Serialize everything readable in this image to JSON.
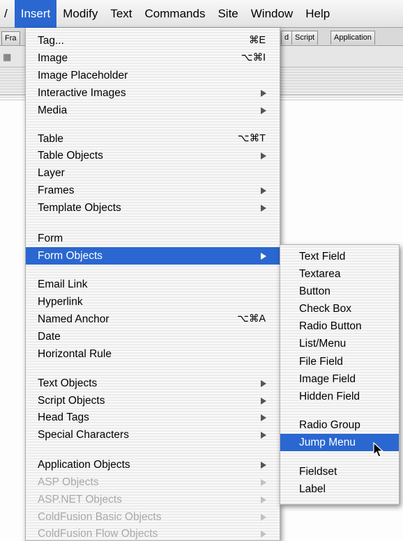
{
  "menubar": {
    "items": [
      {
        "label": "/"
      },
      {
        "label": "Insert",
        "active": true
      },
      {
        "label": "Modify"
      },
      {
        "label": "Text"
      },
      {
        "label": "Commands"
      },
      {
        "label": "Site"
      },
      {
        "label": "Window"
      },
      {
        "label": "Help"
      }
    ]
  },
  "insert_bar": {
    "left_tab": "Fra",
    "right_tabs": [
      "d",
      "Script",
      "Application"
    ]
  },
  "insert_menu": {
    "items": [
      {
        "label": "Tag...",
        "shortcut": "⌘E"
      },
      {
        "label": "Image",
        "shortcut": "⌥⌘I"
      },
      {
        "label": "Image Placeholder"
      },
      {
        "label": "Interactive Images",
        "submenu": true
      },
      {
        "label": "Media",
        "submenu": true
      },
      {
        "label": "Table",
        "shortcut": "⌥⌘T"
      },
      {
        "label": "Table Objects",
        "submenu": true
      },
      {
        "label": "Layer"
      },
      {
        "label": "Frames",
        "submenu": true
      },
      {
        "label": "Template Objects",
        "submenu": true
      },
      {
        "label": "Form"
      },
      {
        "label": "Form Objects",
        "submenu": true,
        "highlighted": true
      },
      {
        "label": "Email Link"
      },
      {
        "label": "Hyperlink"
      },
      {
        "label": "Named Anchor",
        "shortcut": "⌥⌘A"
      },
      {
        "label": "Date"
      },
      {
        "label": "Horizontal Rule"
      },
      {
        "label": "Text Objects",
        "submenu": true
      },
      {
        "label": "Script Objects",
        "submenu": true
      },
      {
        "label": "Head Tags",
        "submenu": true
      },
      {
        "label": "Special Characters",
        "submenu": true
      },
      {
        "label": "Application Objects",
        "submenu": true
      },
      {
        "label": "ASP Objects",
        "submenu": true,
        "disabled": true
      },
      {
        "label": "ASP.NET Objects",
        "submenu": true,
        "disabled": true
      },
      {
        "label": "ColdFusion Basic Objects",
        "submenu": true,
        "disabled": true
      },
      {
        "label": "ColdFusion Flow Objects",
        "submenu": true,
        "disabled": true
      }
    ]
  },
  "form_objects_submenu": {
    "items": [
      {
        "label": "Text Field"
      },
      {
        "label": "Textarea"
      },
      {
        "label": "Button"
      },
      {
        "label": "Check Box"
      },
      {
        "label": "Radio Button"
      },
      {
        "label": "List/Menu"
      },
      {
        "label": "File Field"
      },
      {
        "label": "Image Field"
      },
      {
        "label": "Hidden Field"
      },
      {
        "label": "Radio Group"
      },
      {
        "label": "Jump Menu",
        "highlighted": true
      },
      {
        "label": "Fieldset"
      },
      {
        "label": "Label"
      }
    ]
  },
  "colors": {
    "highlight": "#2a67d0",
    "disabled_text": "#a9a9a9"
  }
}
